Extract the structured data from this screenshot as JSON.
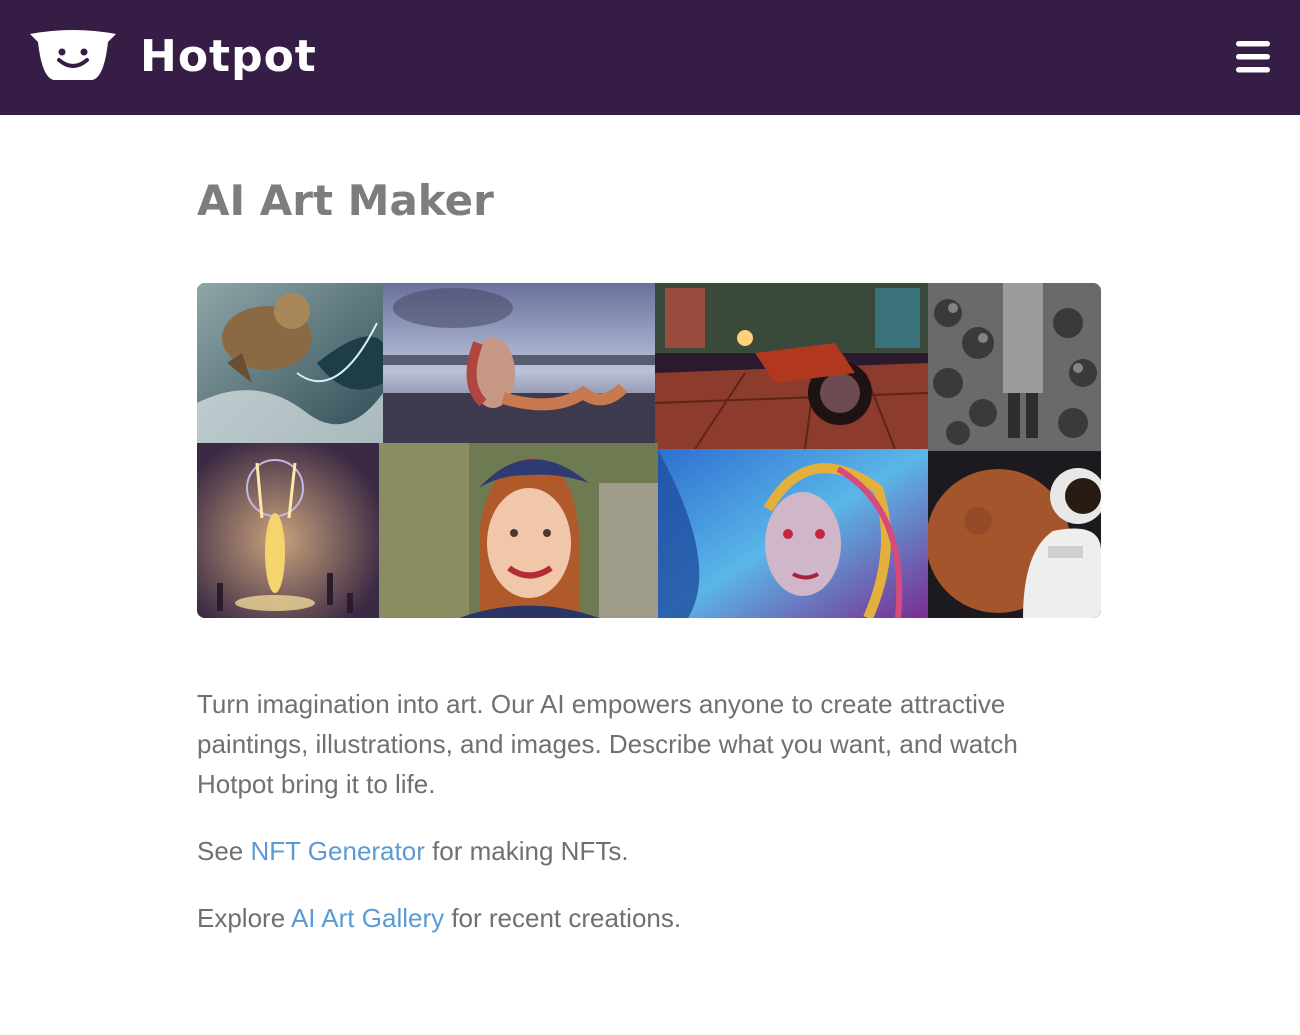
{
  "header": {
    "brand": "Hotpot",
    "logo_icon": "hotpot-smile-logo-icon",
    "menu_icon": "hamburger-menu-icon",
    "background": "#351d45"
  },
  "main": {
    "title": "AI Art Maker",
    "gallery": [
      "werewolf-wave-art",
      "mermaid-on-pier-art",
      "neon-motorcycle-street-art",
      "black-and-white-soldier-photo",
      "glowing-ritual-figure-art",
      "smiling-woman-beret-portrait",
      "colorful-fantasy-woman-art",
      "astronaut-near-mars-art"
    ],
    "intro": "Turn imagination into art. Our AI empowers anyone to create attractive paintings, illustrations, and images. Describe what you want, and watch Hotpot bring it to life.",
    "nft": {
      "before": "See ",
      "link": "NFT Generator",
      "after": " for making NFTs."
    },
    "gallery_line": {
      "before": "Explore ",
      "link": "AI Art Gallery",
      "after": " for recent creations."
    }
  },
  "colors": {
    "link": "#5b9bd5",
    "text": "#707070",
    "title": "#7d7d7d"
  }
}
